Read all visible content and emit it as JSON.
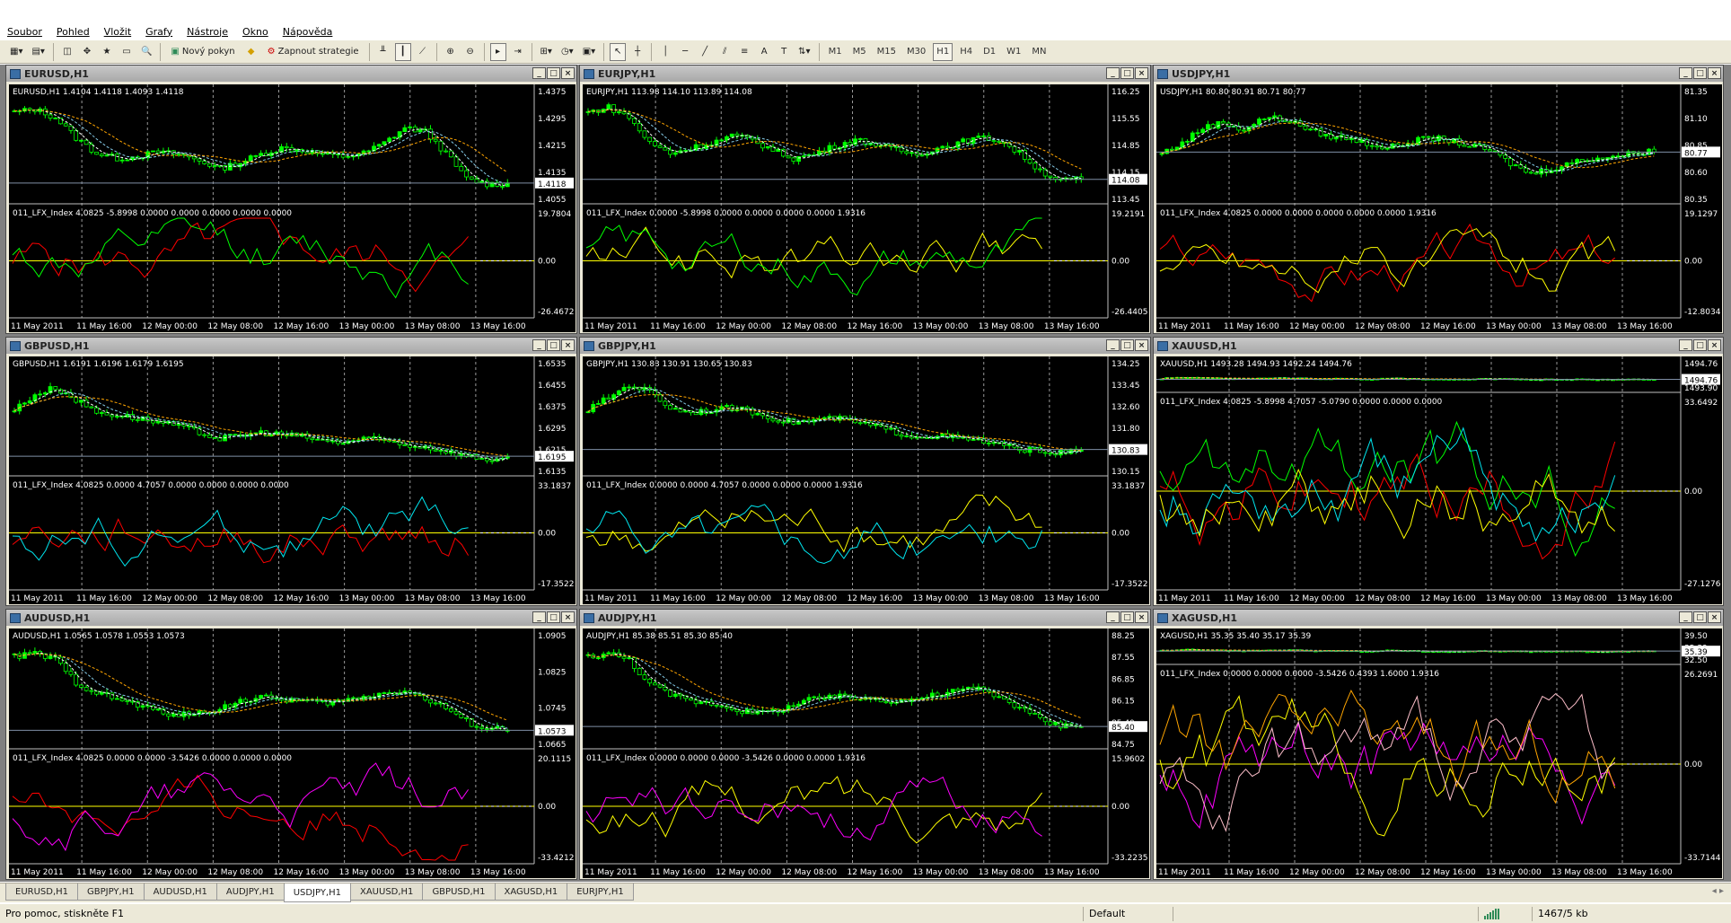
{
  "menu": [
    "Soubor",
    "Pohled",
    "Vložit",
    "Grafy",
    "Nástroje",
    "Okno",
    "Nápověda"
  ],
  "toolbar": {
    "new_order_label": "Nový pokyn",
    "strategy_label": "Zapnout strategie",
    "timeframes": [
      "M1",
      "M5",
      "M15",
      "M30",
      "H1",
      "H4",
      "D1",
      "W1",
      "MN"
    ],
    "active_timeframe": "H1"
  },
  "colors": {
    "chart_bg": "#000000",
    "bull_candle": "#00ff00",
    "bear_candle": "#000000",
    "candle_outline": "#00ff00",
    "ma_fast": "#ffffff",
    "ma_mid": "#87ceeb",
    "ma_slow": "#ffa500",
    "zero_line": "#ffff00",
    "grid": "#c0c0c0"
  },
  "time_labels": [
    "11 May 2011",
    "11 May 16:00",
    "12 May 00:00",
    "12 May 08:00",
    "12 May 16:00",
    "13 May 00:00",
    "13 May 08:00",
    "13 May 16:00"
  ],
  "charts": [
    {
      "title": "EURUSD,H1",
      "header": "EURUSD,H1  1.4104 1.4118 1.4093 1.4118",
      "prices": [
        "1.4375",
        "1.4295",
        "1.4215",
        "1.4135",
        "1.4055"
      ],
      "current": "1.4118",
      "ind_header": "011_LFX_Index 4.0825 -5.8998 0.0000 0.0000 0.0000 0.0000 0.0000",
      "ind_scale": [
        "19.7804",
        "0.00",
        "-26.4672"
      ],
      "indicator_colors": [
        "#ff0000",
        "#00ff00"
      ],
      "trend": [
        0.85,
        0.88,
        0.8,
        0.6,
        0.45,
        0.4,
        0.42,
        0.46,
        0.44,
        0.38,
        0.3,
        0.36,
        0.44,
        0.5,
        0.48,
        0.44,
        0.42,
        0.45,
        0.55,
        0.7,
        0.66,
        0.45,
        0.2,
        0.15,
        0.15
      ]
    },
    {
      "title": "EURJPY,H1",
      "header": "EURJPY,H1  113.98 114.10 113.89 114.08",
      "prices": [
        "116.25",
        "115.55",
        "114.85",
        "114.15",
        "113.45"
      ],
      "current": "114.08",
      "ind_header": "011_LFX_Index 0.0000 -5.8998 0.0000 0.0000 0.0000 0.0000 1.9316",
      "ind_scale": [
        "19.2191",
        "0.00",
        "-26.4405"
      ],
      "indicator_colors": [
        "#ffff00",
        "#00ff00"
      ],
      "trend": [
        0.85,
        0.9,
        0.8,
        0.55,
        0.45,
        0.5,
        0.55,
        0.62,
        0.58,
        0.48,
        0.4,
        0.44,
        0.52,
        0.58,
        0.54,
        0.48,
        0.44,
        0.5,
        0.55,
        0.6,
        0.58,
        0.45,
        0.28,
        0.18,
        0.2
      ]
    },
    {
      "title": "USDJPY,H1",
      "header": "USDJPY,H1  80.80 80.91 80.71 80.77",
      "prices": [
        "81.35",
        "81.10",
        "80.85",
        "80.60",
        "80.35"
      ],
      "current": "80.77",
      "ind_header": "011_LFX_Index 4.0825 0.0000 0.0000 0.0000 0.0000 0.0000 1.9316",
      "ind_scale": [
        "19.1297",
        "0.00",
        "-12.8034"
      ],
      "indicator_colors": [
        "#ff0000",
        "#ffff00"
      ],
      "trend": [
        0.45,
        0.55,
        0.7,
        0.75,
        0.68,
        0.8,
        0.78,
        0.7,
        0.62,
        0.6,
        0.55,
        0.5,
        0.55,
        0.6,
        0.58,
        0.52,
        0.48,
        0.35,
        0.25,
        0.3,
        0.36,
        0.4,
        0.42,
        0.45,
        0.48
      ]
    },
    {
      "title": "GBPUSD,H1",
      "header": "GBPUSD,H1  1.6191 1.6196 1.6179 1.6195",
      "prices": [
        "1.6535",
        "1.6455",
        "1.6375",
        "1.6295",
        "1.6215",
        "1.6135"
      ],
      "current": "1.6195",
      "ind_header": "011_LFX_Index 4.0825 0.0000 4.7057 0.0000 0.0000 0.0000 0.0000",
      "ind_scale": [
        "33.1837",
        "0.00",
        "-17.3522"
      ],
      "indicator_colors": [
        "#ff0000",
        "#00e5ee"
      ],
      "trend": [
        0.6,
        0.75,
        0.82,
        0.7,
        0.58,
        0.55,
        0.52,
        0.48,
        0.44,
        0.38,
        0.32,
        0.35,
        0.38,
        0.36,
        0.34,
        0.3,
        0.28,
        0.32,
        0.3,
        0.26,
        0.24,
        0.2,
        0.15,
        0.12,
        0.12
      ]
    },
    {
      "title": "GBPJPY,H1",
      "header": "GBPJPY,H1  130.83 130.91 130.65 130.83",
      "prices": [
        "134.25",
        "133.45",
        "132.60",
        "131.80",
        "130.95",
        "130.15"
      ],
      "current": "130.83",
      "ind_header": "011_LFX_Index 0.0000 0.0000 4.7057 0.0000 0.0000 0.0000 1.9316",
      "ind_scale": [
        "33.1837",
        "0.00",
        "-17.3522"
      ],
      "indicator_colors": [
        "#ffff00",
        "#00e5ee"
      ],
      "trend": [
        0.6,
        0.72,
        0.85,
        0.78,
        0.62,
        0.58,
        0.6,
        0.62,
        0.58,
        0.52,
        0.48,
        0.5,
        0.52,
        0.48,
        0.44,
        0.38,
        0.34,
        0.35,
        0.32,
        0.3,
        0.26,
        0.22,
        0.2,
        0.18,
        0.2
      ]
    },
    {
      "title": "XAUUSD,H1",
      "header": "XAUUSD,H1  1493.28 1494.93 1492.24 1494.76",
      "prices": [
        "1494.76",
        "1493.90"
      ],
      "current": "1494.76",
      "ind_header": "011_LFX_Index 4.0825 -5.8998 4.7057 -5.0790 0.0000 0.0000 0.0000",
      "ind_scale": [
        "33.6492",
        "0.00",
        "-27.1276"
      ],
      "indicator_colors": [
        "#ff0000",
        "#00ff00",
        "#00e5ee",
        "#ffff00"
      ],
      "trend": [
        0.5,
        0.55,
        0.52,
        0.5,
        0.48,
        0.5,
        0.52,
        0.5,
        0.5,
        0.48,
        0.46,
        0.5,
        0.48,
        0.45,
        0.44,
        0.46,
        0.48,
        0.46,
        0.44,
        0.45,
        0.46,
        0.44,
        0.45,
        0.46,
        0.45
      ]
    },
    {
      "title": "AUDUSD,H1",
      "header": "AUDUSD,H1  1.0565 1.0578 1.0553 1.0573",
      "prices": [
        "1.0905",
        "1.0825",
        "1.0745",
        "1.0665"
      ],
      "current": "1.0573",
      "ind_header": "011_LFX_Index 4.0825 0.0000 0.0000 -3.5426 0.0000 0.0000 0.0000",
      "ind_scale": [
        "20.1115",
        "0.00",
        "-33.4212"
      ],
      "indicator_colors": [
        "#ff0000",
        "#ff00ff"
      ],
      "trend": [
        0.85,
        0.88,
        0.82,
        0.6,
        0.5,
        0.44,
        0.38,
        0.32,
        0.28,
        0.3,
        0.35,
        0.42,
        0.45,
        0.44,
        0.42,
        0.4,
        0.42,
        0.46,
        0.5,
        0.52,
        0.44,
        0.35,
        0.22,
        0.15,
        0.15
      ]
    },
    {
      "title": "AUDJPY,H1",
      "header": "AUDJPY,H1  85.38 85.51 85.30 85.40",
      "prices": [
        "88.25",
        "87.55",
        "86.85",
        "86.15",
        "85.40",
        "84.75"
      ],
      "current": "85.40",
      "ind_header": "011_LFX_Index 0.0000 0.0000 0.0000 -3.5426 0.0000 0.0000 1.9316",
      "ind_scale": [
        "15.9602",
        "0.00",
        "-33.2235"
      ],
      "indicator_colors": [
        "#ffff00",
        "#ff00ff"
      ],
      "trend": [
        0.85,
        0.88,
        0.82,
        0.58,
        0.48,
        0.42,
        0.4,
        0.35,
        0.3,
        0.32,
        0.38,
        0.44,
        0.46,
        0.45,
        0.44,
        0.42,
        0.44,
        0.48,
        0.52,
        0.54,
        0.46,
        0.36,
        0.24,
        0.18,
        0.2
      ]
    },
    {
      "title": "XAGUSD,H1",
      "header": "XAGUSD,H1  35.35 35.40 35.17 35.39",
      "prices": [
        "39.50",
        "35.39",
        "32.50"
      ],
      "current": "35.39",
      "ind_header": "011_LFX_Index 0.0000 0.0000 0.0000 -3.5426 0.4393 1.6000 1.9316",
      "ind_scale": [
        "26.2691",
        "0.00",
        "-33.7144"
      ],
      "indicator_colors": [
        "#ff00ff",
        "#ffff00",
        "#ffa500",
        "#ffc0cb"
      ],
      "trend": [
        0.5,
        0.55,
        0.52,
        0.5,
        0.48,
        0.5,
        0.52,
        0.5,
        0.5,
        0.48,
        0.46,
        0.5,
        0.48,
        0.45,
        0.44,
        0.46,
        0.48,
        0.46,
        0.44,
        0.45,
        0.46,
        0.44,
        0.45,
        0.46,
        0.45
      ]
    }
  ],
  "tabs": [
    "EURUSD,H1",
    "GBPJPY,H1",
    "AUDUSD,H1",
    "AUDJPY,H1",
    "USDJPY,H1",
    "XAUUSD,H1",
    "GBPUSD,H1",
    "XAGUSD,H1",
    "EURJPY,H1"
  ],
  "active_tab": "USDJPY,H1",
  "status": {
    "help": "Pro pomoc, stiskněte F1",
    "profile": "Default",
    "traffic": "1467/5 kb"
  }
}
